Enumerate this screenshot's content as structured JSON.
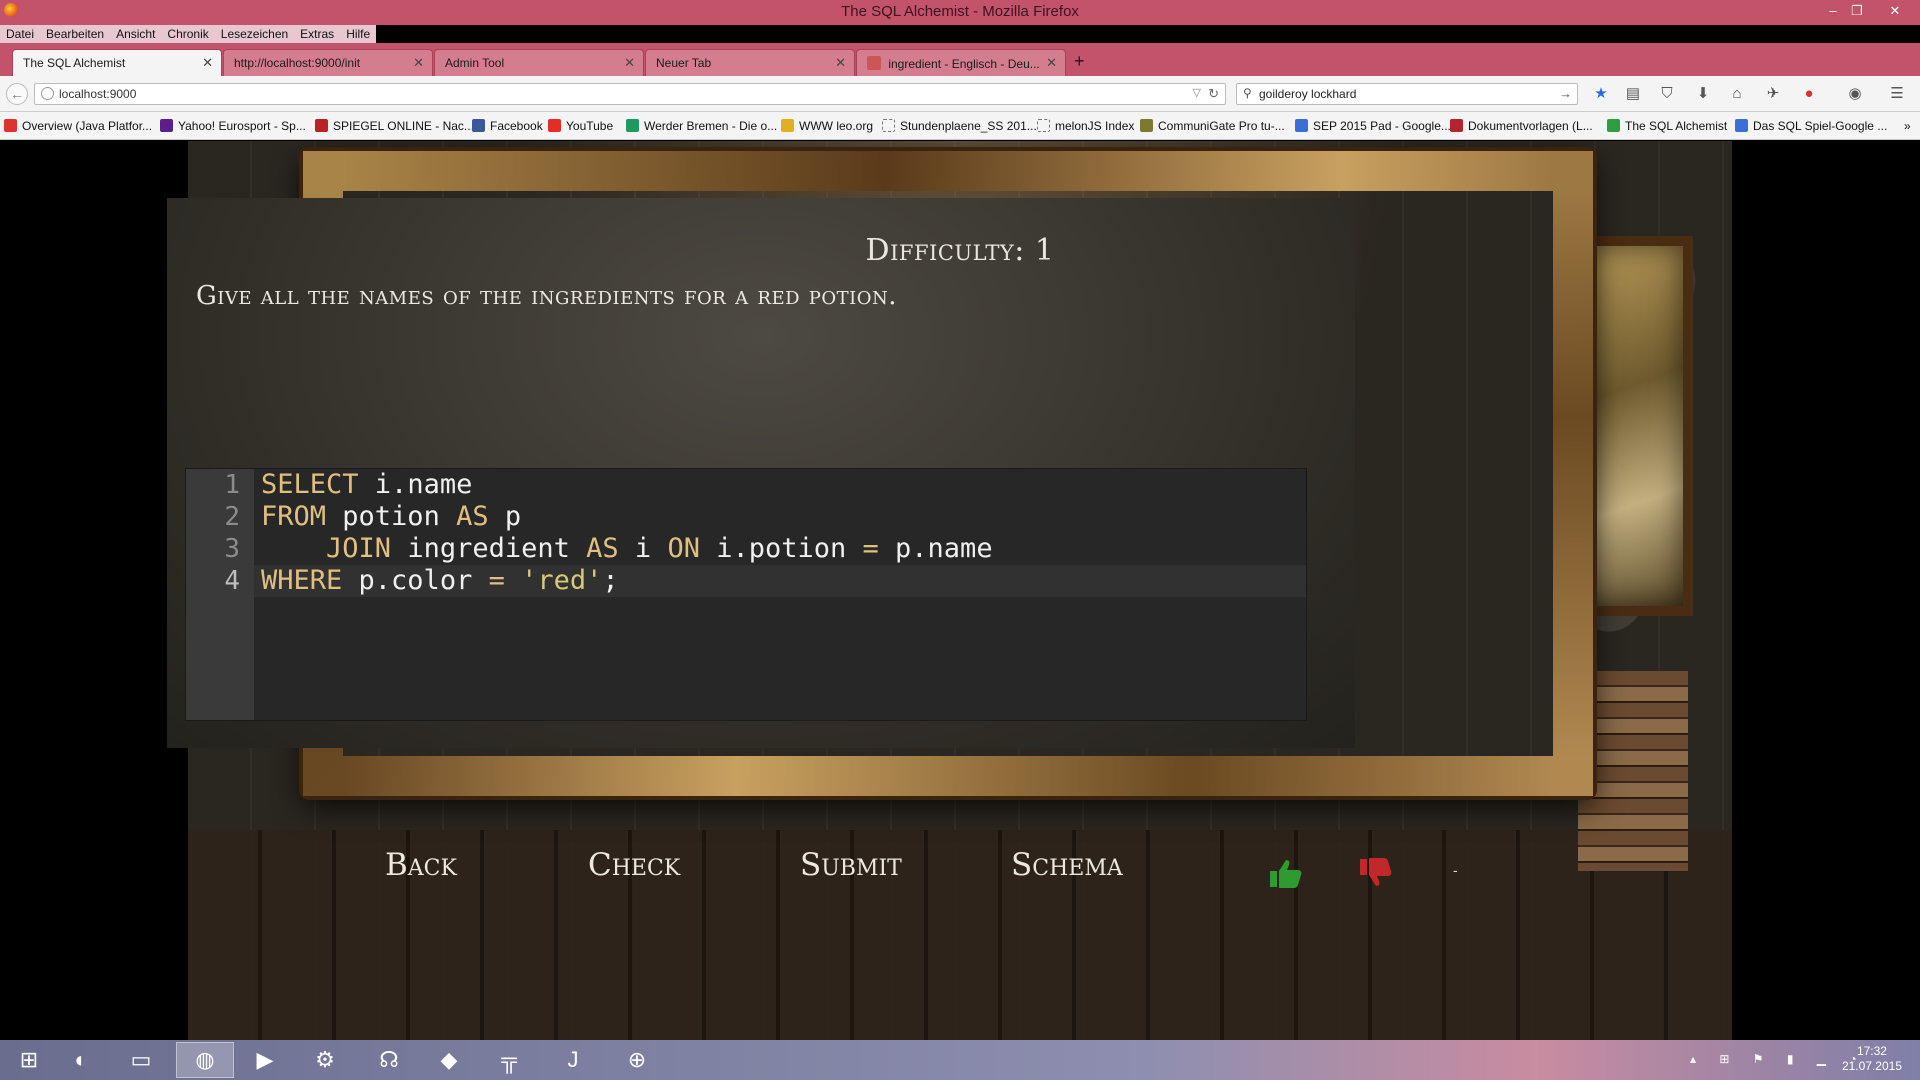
{
  "window": {
    "title": "The SQL Alchemist - Mozilla Firefox"
  },
  "menu": [
    "Datei",
    "Bearbeiten",
    "Ansicht",
    "Chronik",
    "Lesezeichen",
    "Extras",
    "Hilfe"
  ],
  "tabs": [
    {
      "label": "The SQL Alchemist",
      "active": true
    },
    {
      "label": "http://localhost:9000/init"
    },
    {
      "label": "Admin Tool"
    },
    {
      "label": "Neuer Tab"
    },
    {
      "label": "ingredient - Englisch - Deu..."
    }
  ],
  "url": "localhost:9000",
  "search": "goilderoy lockhard",
  "bookmarks": [
    "Overview (Java Platfor...",
    "Yahoo! Eurosport - Sp...",
    "SPIEGEL ONLINE - Nac...",
    "Facebook",
    "YouTube",
    "Werder Bremen - Die o...",
    "WWW leo.org",
    "Stundenplaene_SS 201...",
    "melonJS Index",
    "CommuniGate Pro tu-...",
    "SEP 2015 Pad - Google...",
    "Dokumentvorlagen (L...",
    "The SQL Alchemist",
    "Das SQL Spiel-Google ..."
  ],
  "game": {
    "difficulty": "Difficulty: 1",
    "question": "Give all the names of the ingredients for a red potion.",
    "code_lines": [
      "SELECT i.name",
      "FROM potion AS p",
      "    JOIN ingredient AS i ON i.potion = p.name",
      "WHERE p.color = 'red';"
    ],
    "line_numbers": [
      "1",
      "2",
      "3",
      "4"
    ],
    "buttons": {
      "back": "Back",
      "check": "Check",
      "submit": "Submit",
      "schema": "Schema"
    },
    "minus_label": "-"
  },
  "taskbar": {
    "time": "17:32",
    "date": "21.07.2015"
  },
  "colors": {
    "firefox_chrome": "#c2536a",
    "thumb_up": "#2f9a2f",
    "thumb_down": "#c0282a"
  }
}
